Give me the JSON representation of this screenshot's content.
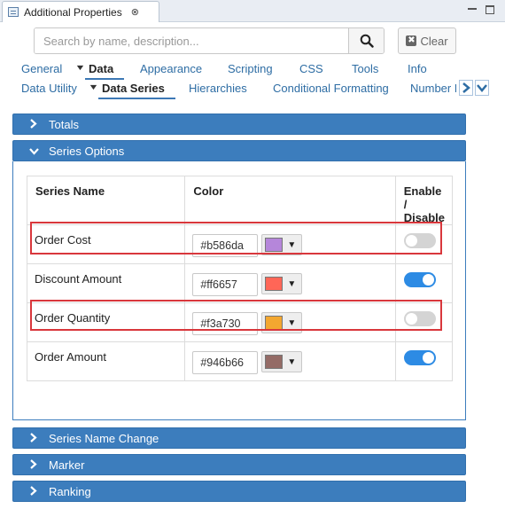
{
  "window": {
    "tab_title": "Additional Properties",
    "tab_close": "⊗"
  },
  "search": {
    "placeholder": "Search by name, description...",
    "clear_label": "Clear",
    "clear_icon": "✖"
  },
  "nav_row1": [
    "General",
    "Data",
    "Appearance",
    "Scripting",
    "CSS",
    "Tools",
    "Info"
  ],
  "nav_row2": [
    "Data Utility",
    "Data Series",
    "Hierarchies",
    "Conditional Formatting",
    "Number Fo"
  ],
  "active_tabs": [
    "Data",
    "Data Series"
  ],
  "sections": {
    "totals": "Totals",
    "series_options": "Series Options",
    "series_name_change": "Series Name Change",
    "marker": "Marker",
    "ranking": "Ranking"
  },
  "table": {
    "col_name": "Series Name",
    "col_color": "Color",
    "col_enable_1": "Enable /",
    "col_enable_2": "Disable",
    "rows": [
      {
        "name": "Order Cost",
        "hex": "#b586da",
        "enabled": false
      },
      {
        "name": "Discount Amount",
        "hex": "#ff6657",
        "enabled": true
      },
      {
        "name": "Order Quantity",
        "hex": "#f3a730",
        "enabled": false
      },
      {
        "name": "Order Amount",
        "hex": "#946b66",
        "enabled": true
      }
    ]
  },
  "colors": {
    "accent": "#3c7dbd",
    "link": "#2e6da4",
    "highlight": "#d9373c",
    "toggle_on": "#2d8be4",
    "toggle_off": "#d4d4d4"
  },
  "icons": {
    "search": "search-icon",
    "clear": "clear-x-icon",
    "expand_collapsed": "chevron-right-icon",
    "expand_open": "chevron-down-icon",
    "scroll_right": "chevron-right-icon",
    "scroll_more": "chevron-down-icon",
    "dropdown": "caret-down-icon"
  }
}
